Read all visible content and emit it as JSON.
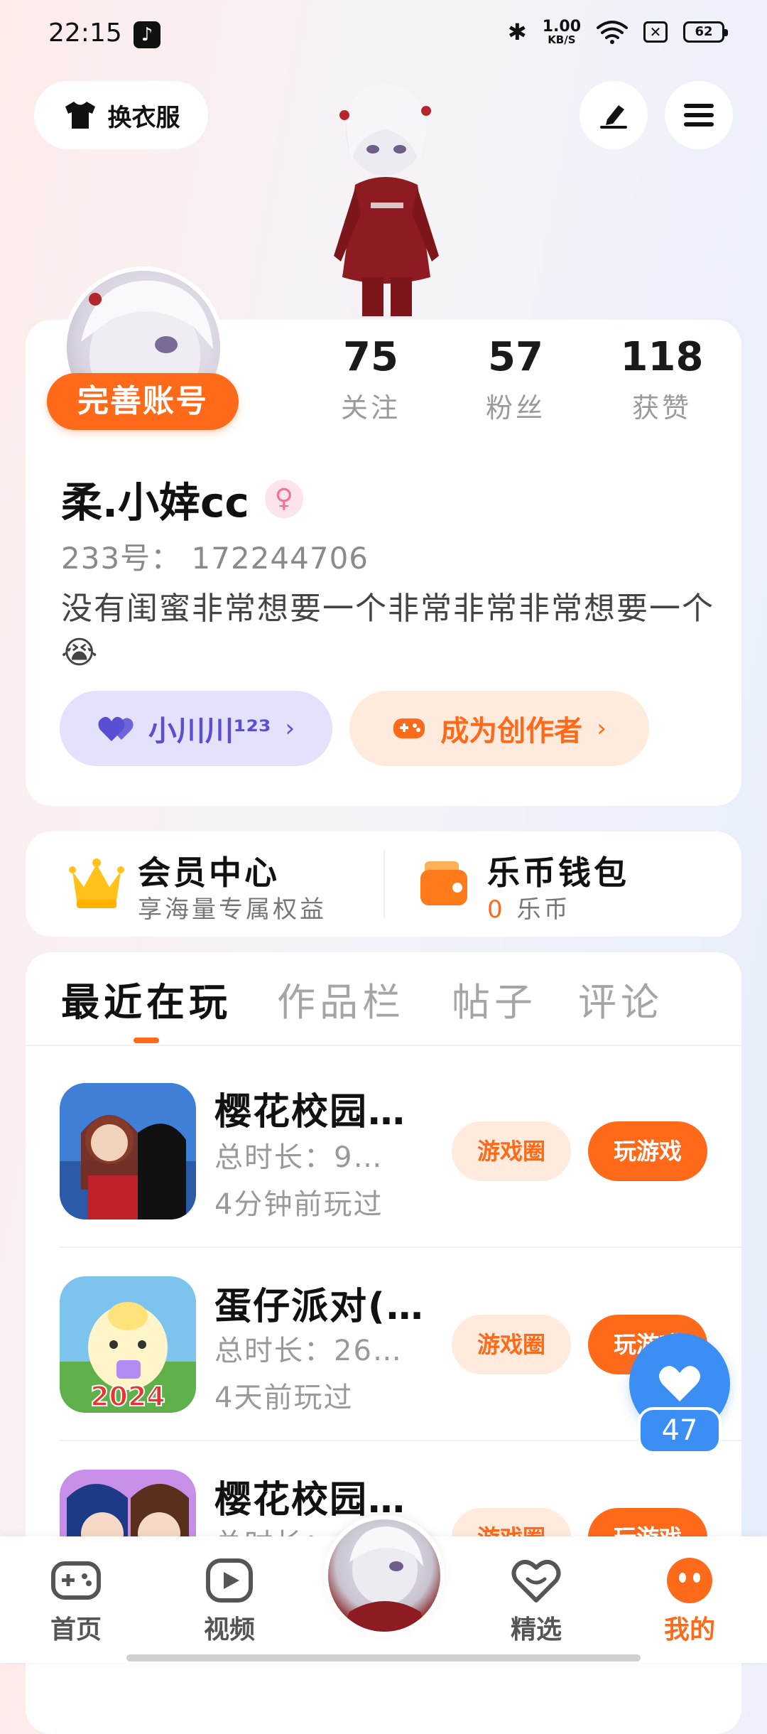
{
  "status_bar": {
    "time": "22:15",
    "net_speed_value": "1.00",
    "net_speed_unit": "KB/S",
    "battery": "62"
  },
  "top_bar": {
    "outfit_label": "换衣服"
  },
  "profile": {
    "complete_account_label": "完善账号",
    "stats": [
      {
        "value": "75",
        "label": "关注"
      },
      {
        "value": "57",
        "label": "粉丝"
      },
      {
        "value": "118",
        "label": "获赞"
      }
    ],
    "username": "柔.小婞cc",
    "gender_symbol": "♀",
    "uid": "233号：  172244706",
    "bio": "没有闺蜜非常想要一个非常非常非常想要一个 😭",
    "friend_label": "小川川¹²³",
    "creator_label": "成为创作者"
  },
  "vip": {
    "title": "会员中心",
    "subtitle": "享海量专属权益"
  },
  "wallet": {
    "title": "乐币钱包",
    "coin_value": "0",
    "coin_unit": "乐币"
  },
  "tabs": [
    "最近在玩",
    "作品栏",
    "帖子",
    "评论"
  ],
  "games": [
    {
      "title": "樱花校园…",
      "duration": "总时长：9…",
      "last_played": "4分钟前玩过",
      "circle_label": "游戏圈",
      "play_label": "玩游戏"
    },
    {
      "title": "蛋仔派对(…",
      "duration": "总时长：26…",
      "last_played": "4天前玩过",
      "circle_label": "游戏圈",
      "play_label": "玩游戏",
      "thumb_badge": "2024"
    },
    {
      "title": "樱花校园…",
      "duration": "总时长：",
      "last_played": "",
      "circle_label": "游戏圈",
      "play_label": "玩游戏"
    }
  ],
  "floating_like": {
    "count": "47"
  },
  "bottom_nav": {
    "home": "首页",
    "video": "视频",
    "featured": "精选",
    "mine": "我的"
  },
  "colors": {
    "accent": "#ff6a1a",
    "friend_pill_bg": "#e3e1fb",
    "friend_pill_text": "#5a4fd3",
    "like_blue": "#3b8ef3"
  }
}
